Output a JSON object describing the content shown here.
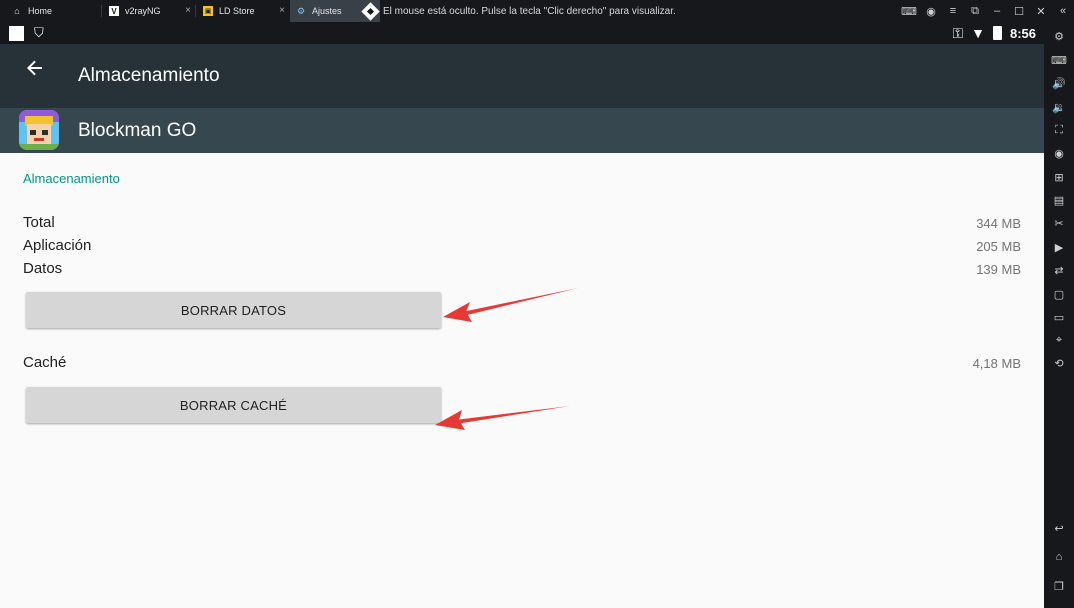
{
  "tabs": [
    {
      "label": "Home",
      "icon": "home-icon"
    },
    {
      "label": "v2rayNG",
      "icon": "v2rayng-app-icon"
    },
    {
      "label": "LD Store",
      "icon": "ldstore-app-icon"
    },
    {
      "label": "Ajustes",
      "icon": "settings-icon"
    }
  ],
  "mouse_message": "El mouse está oculto. Pulse la tecla  \"Clic derecho\" para visualizar.",
  "status_bar": {
    "time": "8:56"
  },
  "appbar": {
    "title": "Almacenamiento"
  },
  "app": {
    "name": "Blockman GO"
  },
  "storage": {
    "section_title": "Almacenamiento",
    "rows": [
      {
        "label": "Total",
        "value": "344 MB"
      },
      {
        "label": "Aplicación",
        "value": "205 MB"
      },
      {
        "label": "Datos",
        "value": "139 MB"
      }
    ],
    "clear_data_button": "BORRAR DATOS",
    "cache_label": "Caché",
    "cache_value": "4,18 MB",
    "clear_cache_button": "BORRAR CACHÉ"
  },
  "colors": {
    "appbar": "#263238",
    "app_row": "#37474f",
    "accent": "#009688",
    "annotation_arrow": "#e53935"
  }
}
